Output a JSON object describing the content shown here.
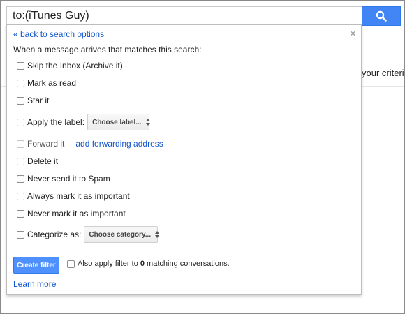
{
  "search": {
    "query": "to:(iTunes Guy)"
  },
  "background": {
    "criteria_text": "your criteria."
  },
  "panel": {
    "back_link": "« back to search options",
    "close_symbol": "×",
    "intro": "When a message arrives that matches this search:",
    "options": {
      "skip_inbox": "Skip the Inbox (Archive it)",
      "mark_read": "Mark as read",
      "star_it": "Star it",
      "apply_label": "Apply the label:",
      "forward_it": "Forward it",
      "delete_it": "Delete it",
      "never_spam": "Never send it to Spam",
      "always_important": "Always mark it as important",
      "never_important": "Never mark it as important",
      "categorize": "Categorize as:"
    },
    "label_select": "Choose label...",
    "add_forwarding": "add forwarding address",
    "category_select": "Choose category...",
    "create_button": "Create filter",
    "also_apply_prefix": "Also apply filter to ",
    "match_count": "0",
    "also_apply_suffix": " matching conversations.",
    "learn_more": "Learn more"
  },
  "colors": {
    "accent_blue": "#4285f4",
    "link_blue": "#1155cc"
  },
  "icons": {
    "search_button_icon": "search-icon"
  }
}
